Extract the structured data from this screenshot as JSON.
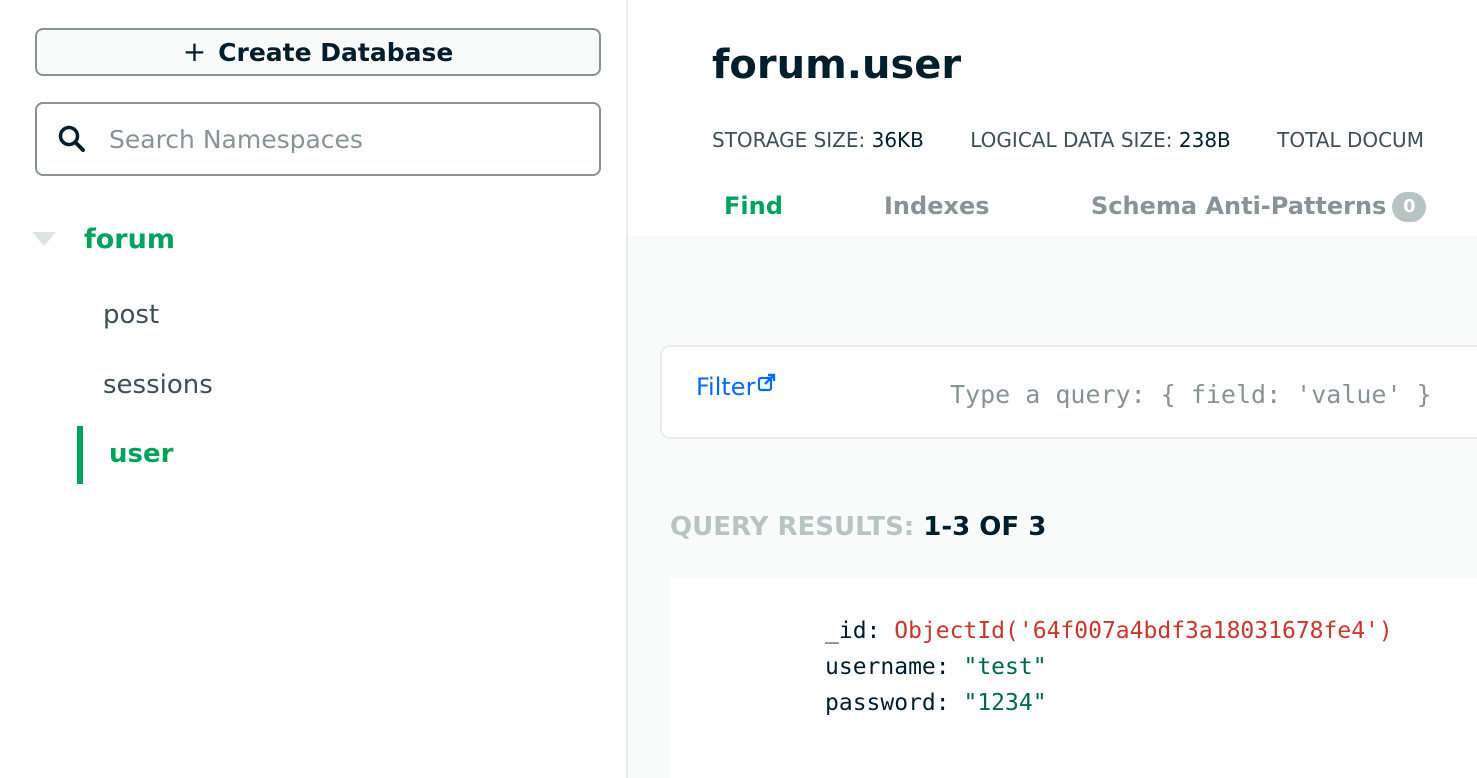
{
  "sidebar": {
    "create_database_label": "Create Database",
    "search_placeholder": "Search Namespaces",
    "database": "forum",
    "collections": [
      "post",
      "sessions",
      "user"
    ],
    "active_collection": "user"
  },
  "main": {
    "title": "forum.user",
    "stats": [
      {
        "label": "STORAGE SIZE:",
        "value": "36KB"
      },
      {
        "label": "LOGICAL DATA SIZE:",
        "value": "238B"
      },
      {
        "label": "TOTAL DOCUM",
        "value": ""
      }
    ],
    "tabs": [
      {
        "label": "Find",
        "active": true
      },
      {
        "label": "Indexes",
        "active": false
      },
      {
        "label": "Schema Anti-Patterns",
        "active": false,
        "badge": "0"
      }
    ],
    "filter_label": "Filter",
    "filter_placeholder": "Type a query: { field: 'value' }",
    "results_label": "QUERY RESULTS:",
    "results_count": "1-3 OF 3",
    "document": {
      "id_key": "_id:",
      "id_value": "ObjectId('64f007a4bdf3a18031678fe4')",
      "username_key": "username:",
      "username_value": "\"test\"",
      "password_key": "password:",
      "password_value": "\"1234\""
    }
  },
  "colors": {
    "accent_green": "#00a35c",
    "link_blue": "#016bf8",
    "objectid_red": "#c8372d",
    "string_green": "#00684a"
  }
}
